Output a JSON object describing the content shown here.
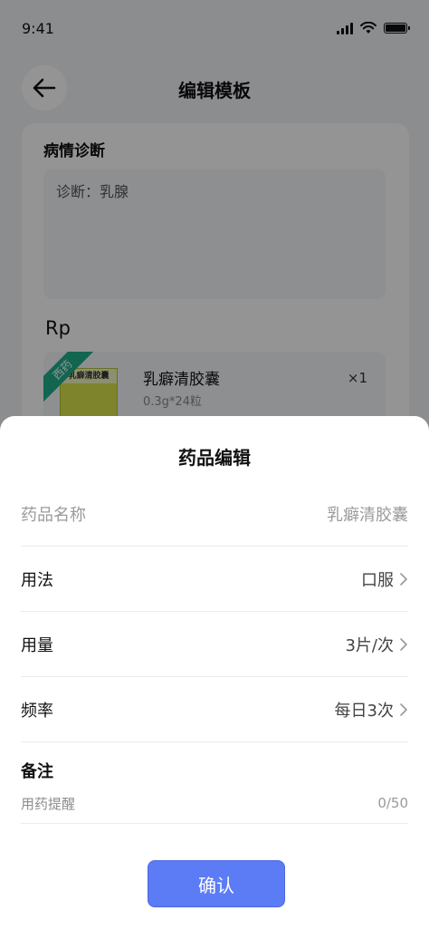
{
  "status_bar": {
    "time": "9:41"
  },
  "nav": {
    "title": "编辑模板",
    "back_icon": "arrow-left-icon"
  },
  "template": {
    "diagnosis_label": "病情诊断",
    "diagnosis_value": "诊断：乳腺",
    "rp_label": "Rp",
    "drug": {
      "tag": "西药",
      "package_text": "乳癖清胶囊",
      "name": "乳癖清胶囊",
      "spec": "0.3g*24粒",
      "quantity": "×1"
    }
  },
  "sheet": {
    "title": "药品编辑",
    "fields": [
      {
        "label": "药品名称",
        "value": "乳癖清胶囊",
        "editable": false
      },
      {
        "label": "用法",
        "value": "口服",
        "editable": true
      },
      {
        "label": "用量",
        "value": "3片/次",
        "editable": true
      },
      {
        "label": "频率",
        "value": "每日3次",
        "editable": true
      }
    ],
    "note": {
      "label": "备注",
      "placeholder": "用药提醒",
      "count": "0/50"
    },
    "confirm_label": "确认"
  },
  "colors": {
    "primary": "#5c7cf6",
    "drug_tag": "#1fae8a",
    "overlay": "rgba(0,0,0,0.42)"
  }
}
